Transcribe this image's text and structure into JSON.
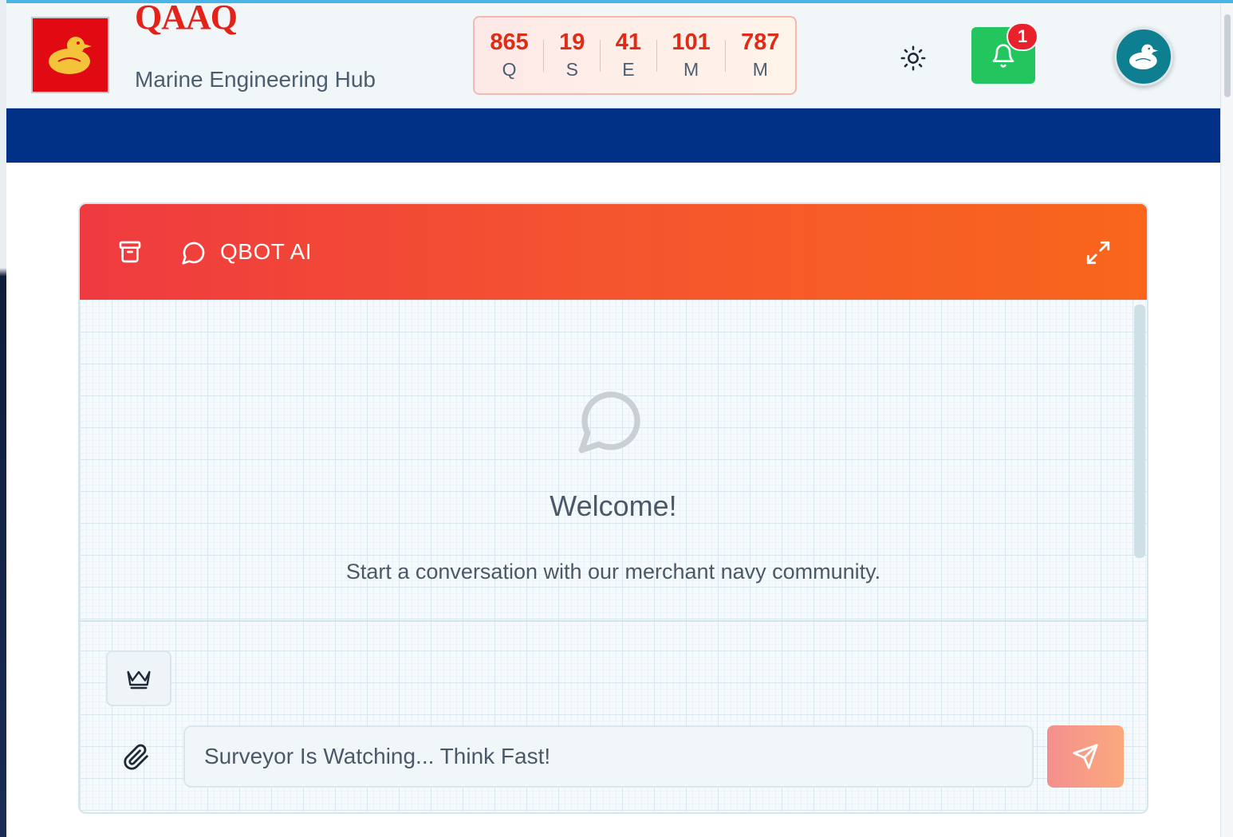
{
  "header": {
    "brand": "QAAQ",
    "tagline": "Marine Engineering Hub",
    "stats": [
      {
        "value": "865",
        "label": "Q"
      },
      {
        "value": "19",
        "label": "S"
      },
      {
        "value": "41",
        "label": "E"
      },
      {
        "value": "101",
        "label": "M"
      },
      {
        "value": "787",
        "label": "M"
      }
    ],
    "notification_count": "1",
    "icons": {
      "theme": "sun-icon",
      "notifications": "bell-icon",
      "logo": "duck-logo",
      "avatar": "duck-avatar"
    }
  },
  "chat": {
    "title": "QBOT AI",
    "welcome_title": "Welcome!",
    "welcome_subtitle": "Start a conversation with our merchant navy community.",
    "input_placeholder": "Surveyor Is Watching... Think Fast!",
    "icons": {
      "archive": "archive-icon",
      "chat": "chat-bubble-icon",
      "expand": "expand-icon",
      "crown": "crown-icon",
      "attach": "paperclip-icon",
      "send": "send-icon"
    }
  },
  "colors": {
    "accent_top": "#49b4e6",
    "navbar": "#013186",
    "brand_red": "#e2231a",
    "chat_header_start": "#ef3a40",
    "chat_header_end": "#f9661c",
    "bell_green": "#22c55e",
    "badge_red": "#e8222c"
  }
}
